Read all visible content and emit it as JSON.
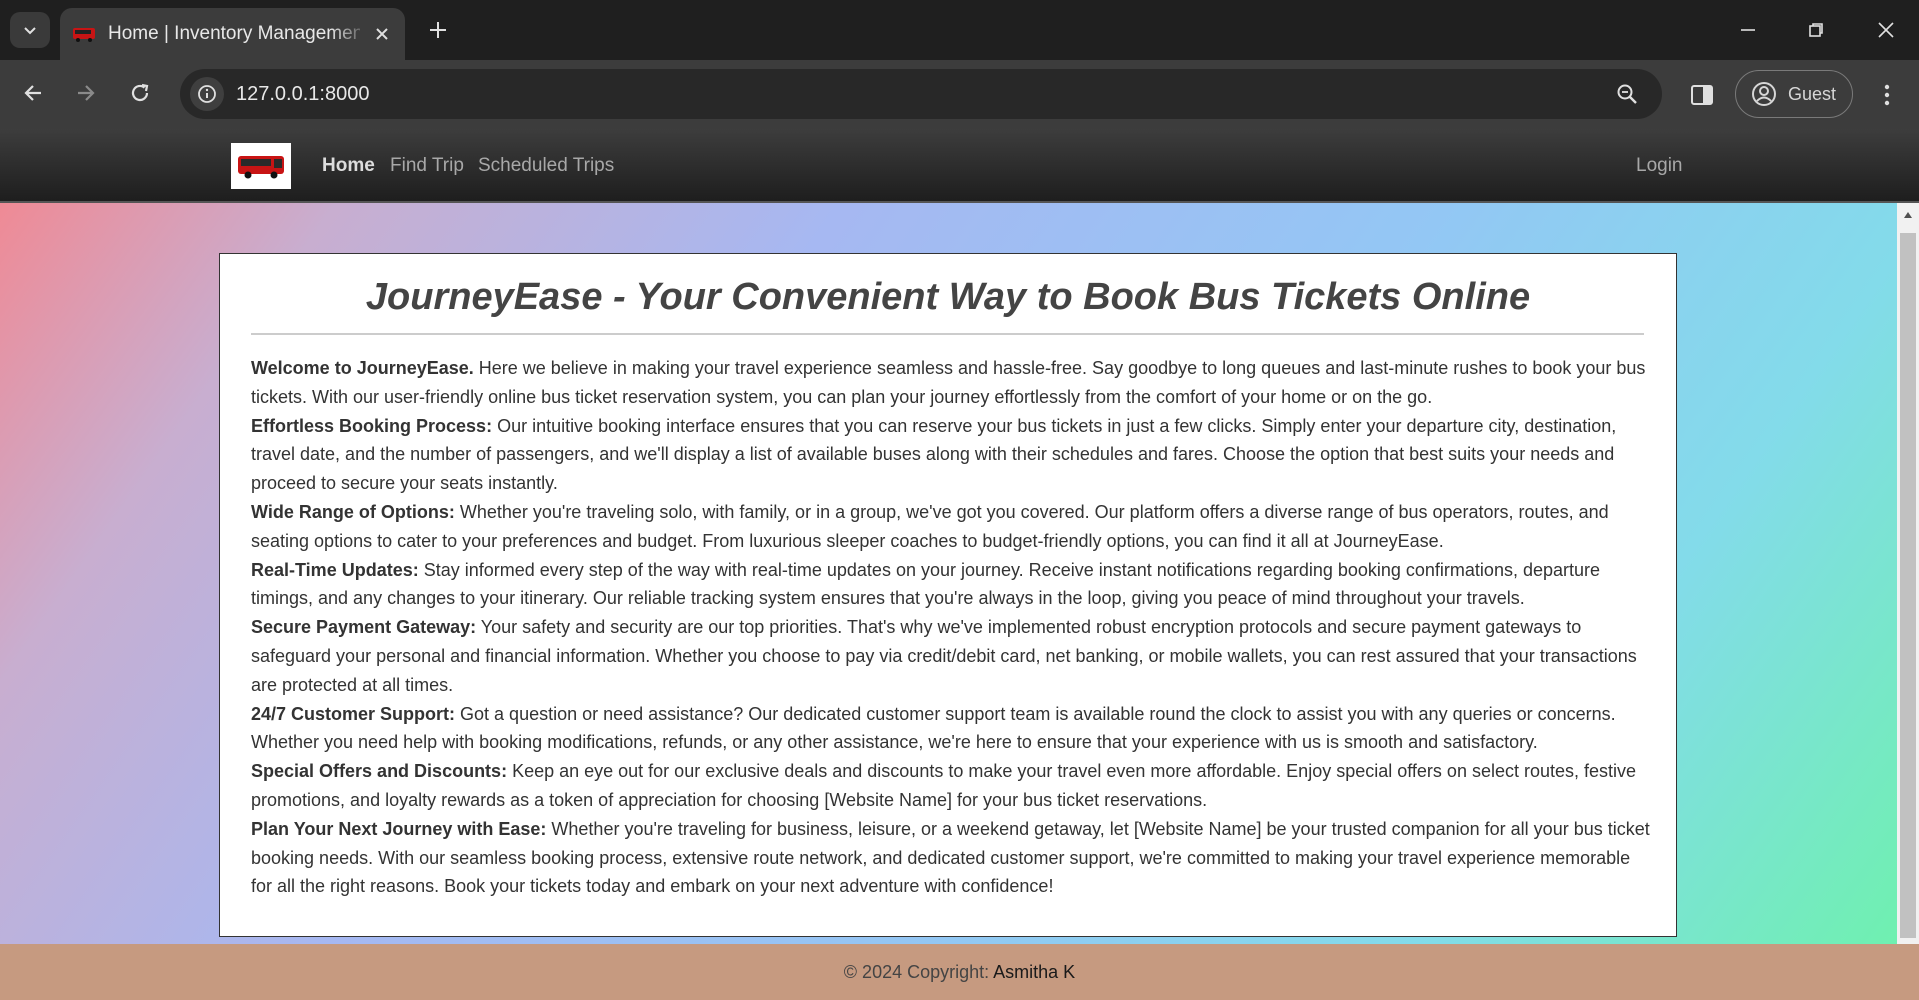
{
  "browser": {
    "tab_title": "Home | Inventory Management",
    "url": "127.0.0.1:8000",
    "profile_label": "Guest"
  },
  "navbar": {
    "links": [
      "Home",
      "Find Trip",
      "Scheduled Trips"
    ],
    "login": "Login"
  },
  "main": {
    "headline": "JourneyEase - Your Convenient Way to Book Bus Tickets Online",
    "sections": [
      {
        "title": "Welcome to JourneyEase.",
        "text": " Here we believe in making your travel experience seamless and hassle-free. Say goodbye to long queues and last-minute rushes to book your bus tickets. With our user-friendly online bus ticket reservation system, you can plan your journey effortlessly from the comfort of your home or on the go."
      },
      {
        "title": "Effortless Booking Process:",
        "text": " Our intuitive booking interface ensures that you can reserve your bus tickets in just a few clicks. Simply enter your departure city, destination, travel date, and the number of passengers, and we'll display a list of available buses along with their schedules and fares. Choose the option that best suits your needs and proceed to secure your seats instantly."
      },
      {
        "title": "Wide Range of Options:",
        "text": " Whether you're traveling solo, with family, or in a group, we've got you covered. Our platform offers a diverse range of bus operators, routes, and seating options to cater to your preferences and budget. From luxurious sleeper coaches to budget-friendly options, you can find it all at JourneyEase."
      },
      {
        "title": "Real-Time Updates:",
        "text": " Stay informed every step of the way with real-time updates on your journey. Receive instant notifications regarding booking confirmations, departure timings, and any changes to your itinerary. Our reliable tracking system ensures that you're always in the loop, giving you peace of mind throughout your travels."
      },
      {
        "title": "Secure Payment Gateway:",
        "text": " Your safety and security are our top priorities. That's why we've implemented robust encryption protocols and secure payment gateways to safeguard your personal and financial information. Whether you choose to pay via credit/debit card, net banking, or mobile wallets, you can rest assured that your transactions are protected at all times."
      },
      {
        "title": "24/7 Customer Support:",
        "text": " Got a question or need assistance? Our dedicated customer support team is available round the clock to assist you with any queries or concerns. Whether you need help with booking modifications, refunds, or any other assistance, we're here to ensure that your experience with us is smooth and satisfactory."
      },
      {
        "title": "Special Offers and Discounts:",
        "text": " Keep an eye out for our exclusive deals and discounts to make your travel even more affordable. Enjoy special offers on select routes, festive promotions, and loyalty rewards as a token of appreciation for choosing [Website Name] for your bus ticket reservations."
      },
      {
        "title": "Plan Your Next Journey with Ease:",
        "text": " Whether you're traveling for business, leisure, or a weekend getaway, let [Website Name] be your trusted companion for all your bus ticket booking needs. With our seamless booking process, extensive route network, and dedicated customer support, we're committed to making your travel experience memorable for all the right reasons. Book your tickets today and embark on your next adventure with confidence!"
      }
    ]
  },
  "footer": {
    "prefix": "© 2024 Copyright: ",
    "author": "Asmitha K"
  },
  "colors": {
    "footer_bg": "#c69a80",
    "navbar_bg": "#2b2b2b",
    "headline": "#444444"
  }
}
